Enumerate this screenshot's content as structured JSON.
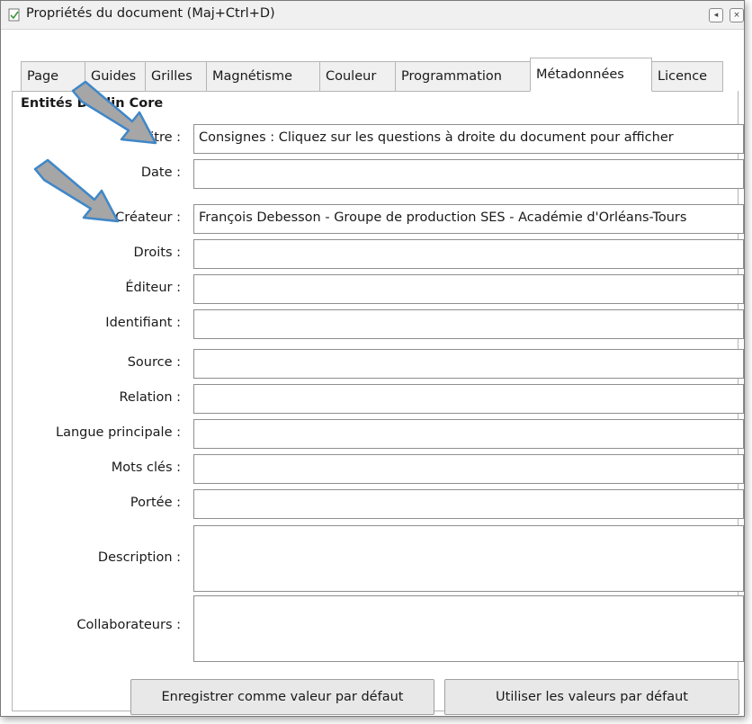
{
  "window": {
    "title": "Propriétés du document (Maj+Ctrl+D)",
    "collapse_glyph": "◂",
    "close_glyph": "×"
  },
  "tabs": [
    {
      "label": "Page",
      "active": false
    },
    {
      "label": "Guides",
      "active": false
    },
    {
      "label": "Grilles",
      "active": false
    },
    {
      "label": "Magnétisme",
      "active": false
    },
    {
      "label": "Couleur",
      "active": false
    },
    {
      "label": "Programmation",
      "active": false
    },
    {
      "label": "Métadonnées",
      "active": true
    },
    {
      "label": "Licence",
      "active": false
    }
  ],
  "section_title": "Entités Dublin Core",
  "fields": [
    {
      "label": "Titre :",
      "value": "Consignes : Cliquez sur les questions à droite du document pour afficher"
    },
    {
      "label": "Date :",
      "value": ""
    },
    {
      "label": "Créateur :",
      "value": "François Debesson - Groupe de production SES - Académie d'Orléans-Tours"
    },
    {
      "label": "Droits :",
      "value": ""
    },
    {
      "label": "Éditeur :",
      "value": ""
    },
    {
      "label": "Identifiant :",
      "value": ""
    },
    {
      "label": "Source :",
      "value": ""
    },
    {
      "label": "Relation :",
      "value": ""
    },
    {
      "label": "Langue principale :",
      "value": ""
    },
    {
      "label": "Mots clés :",
      "value": ""
    },
    {
      "label": "Portée :",
      "value": ""
    },
    {
      "label": "Description :",
      "value": ""
    },
    {
      "label": "Collaborateurs :",
      "value": ""
    }
  ],
  "buttons": {
    "save_default": "Enregistrer comme valeur par défaut",
    "use_default": "Utiliser les valeurs par défaut"
  },
  "colors": {
    "annotation_arrow_fill": "#a6a6a6",
    "annotation_arrow_outline": "#3f87c9"
  }
}
